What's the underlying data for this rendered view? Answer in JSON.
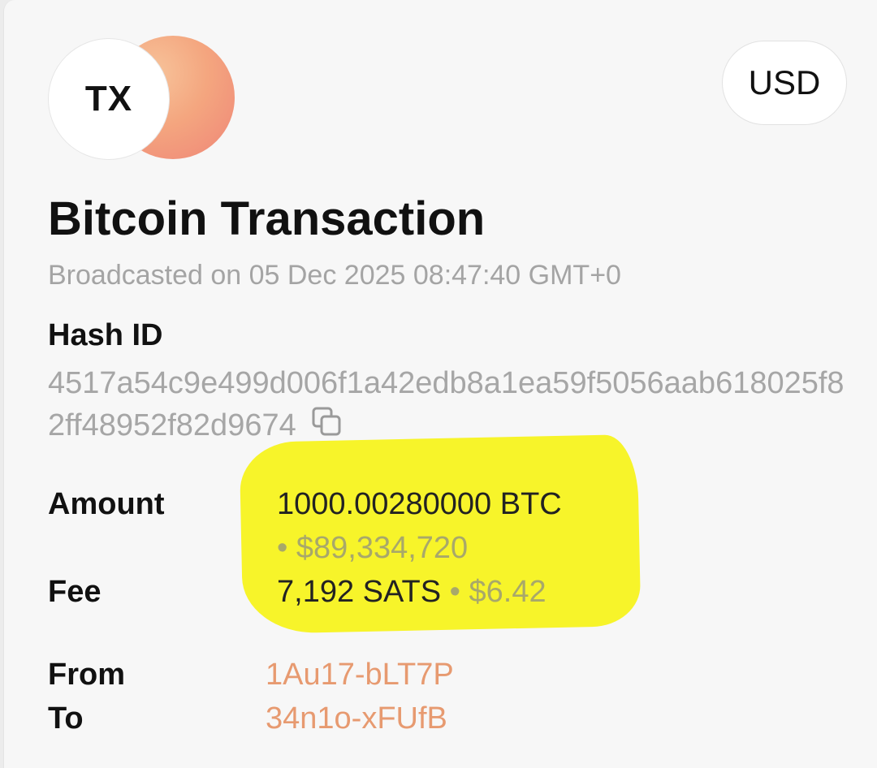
{
  "header": {
    "logo_text": "TX",
    "currency_label": "USD"
  },
  "transaction": {
    "title": "Bitcoin Transaction",
    "broadcast": "Broadcasted on 05 Dec 2025 08:47:40 GMT+0",
    "hash_label": "Hash ID",
    "hash_value": "4517a54c9e499d006f1a42edb8a1ea59f5056aab618025f82ff48952f82d9674",
    "amount_label": "Amount",
    "amount_btc": "1000.00280000 BTC",
    "amount_usd": "• $89,334,720",
    "fee_label": "Fee",
    "fee_sats": "7,192 SATS",
    "fee_usd": "• $6.42",
    "from_label": "From",
    "from_address": "1Au17-bLT7P",
    "to_label": "To",
    "to_address": "34n1o-xFUfB"
  },
  "colors": {
    "highlight": "#f7f42a",
    "address": "#e79a70",
    "muted_text": "#a6a6a6"
  },
  "icons": {
    "copy": "copy-icon"
  }
}
